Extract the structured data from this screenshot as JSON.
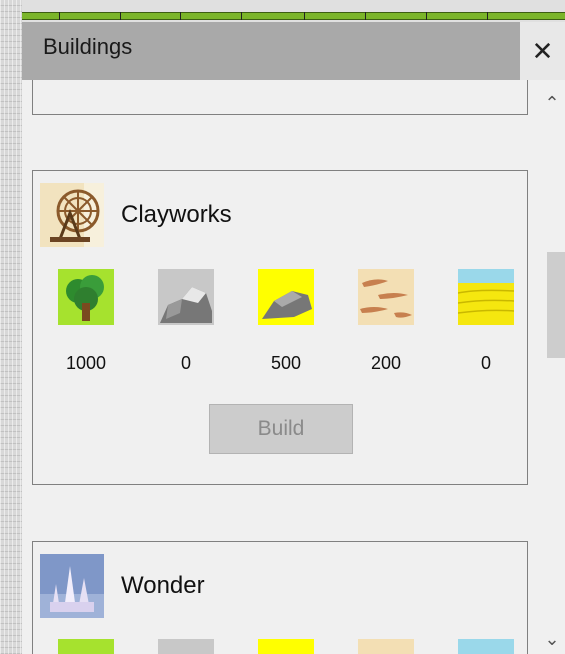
{
  "window": {
    "title": "Buildings",
    "close_label": "✕"
  },
  "cards": [
    {
      "name": "Clayworks",
      "icon": "clayworks-waterwheel-icon",
      "costs": [
        {
          "resource": "wood",
          "icon": "tree-icon",
          "value": "1000"
        },
        {
          "resource": "stone",
          "icon": "grey-rock-icon",
          "value": "0"
        },
        {
          "resource": "gold",
          "icon": "yellow-rock-icon",
          "value": "500"
        },
        {
          "resource": "clay",
          "icon": "clay-icon",
          "value": "200"
        },
        {
          "resource": "wheat",
          "icon": "wheat-field-icon",
          "value": "0"
        }
      ],
      "build_label": "Build",
      "build_enabled": false
    },
    {
      "name": "Wonder",
      "icon": "wonder-castle-icon"
    }
  ],
  "colors": {
    "titlebar": "#a9a9a9",
    "panel": "#f0f0f0",
    "card_border": "#808080",
    "build_disabled": "#cccccc"
  }
}
